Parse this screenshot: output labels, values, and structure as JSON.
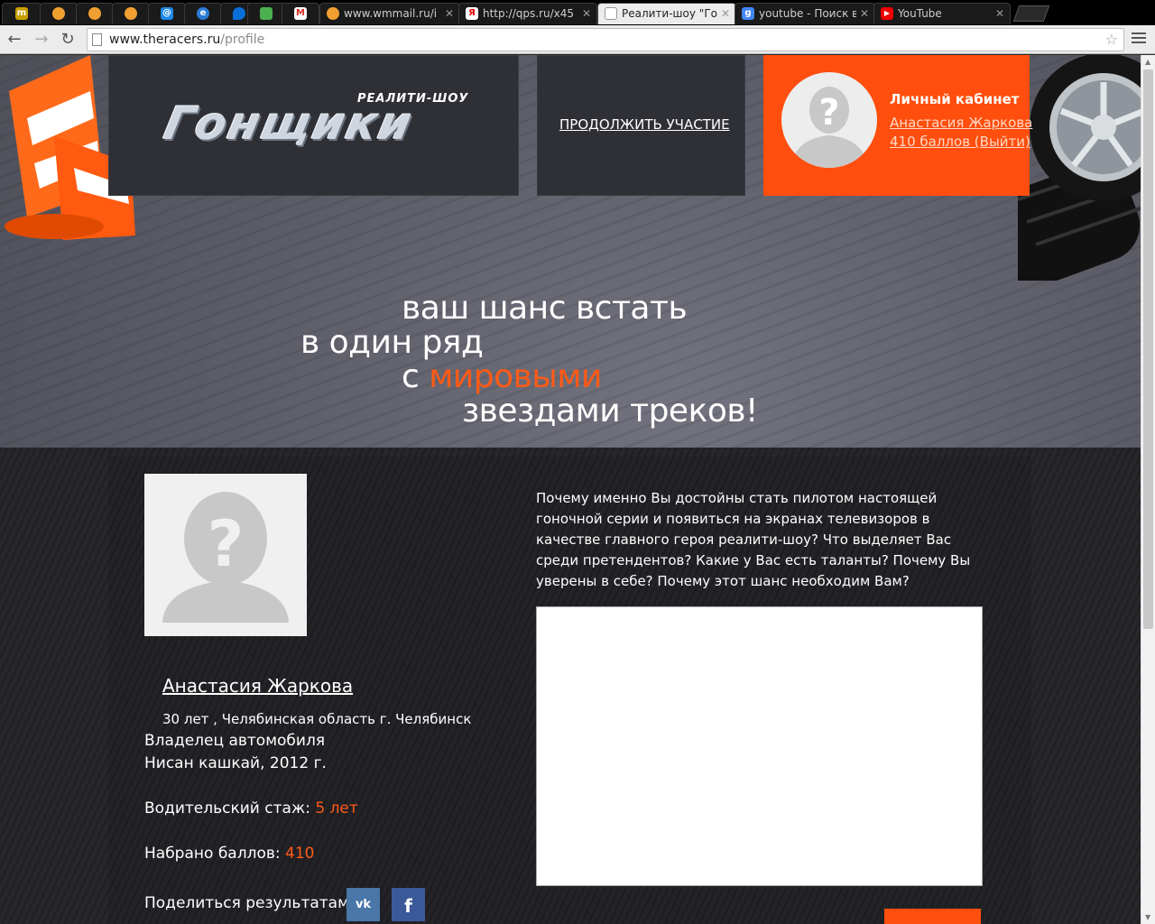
{
  "browser": {
    "tabs": [
      {
        "label": "",
        "icon": "tm-icon"
      },
      {
        "label": "",
        "icon": "ball-icon"
      },
      {
        "label": "",
        "icon": "ball-icon"
      },
      {
        "label": "",
        "icon": "ball-icon"
      },
      {
        "label": "",
        "icon": "at-icon"
      },
      {
        "label": "",
        "icon": "globe-icon"
      },
      {
        "label": "",
        "icon": "pin-icon"
      },
      {
        "label": "",
        "icon": "image-icon"
      },
      {
        "label": "",
        "icon": "gmail-icon"
      },
      {
        "label": "www.wmmail.ru/i",
        "icon": "ball-icon"
      },
      {
        "label": "http://qps.ru/x45",
        "icon": "yandex-icon"
      },
      {
        "label": "Реалити-шоу \"Го",
        "icon": "page-icon"
      },
      {
        "label": "youtube - Поиск в",
        "icon": "google-icon"
      },
      {
        "label": "YouTube",
        "icon": "youtube-icon"
      }
    ],
    "url_domain": "www.theracers.ru",
    "url_path": "/profile"
  },
  "header": {
    "logo_subtitle": "РЕАЛИТИ-ШОУ",
    "logo_title": "Гонщики",
    "continue_label": "ПРОДОЛЖИТЬ УЧАСТИЕ",
    "cabinet_title": "Личный кабинет",
    "cabinet_name": "Анастасия Жаркова",
    "cabinet_points": "410 баллов (Выйти)"
  },
  "slogan": {
    "line1": "ваш шанс встать",
    "line2": "в один ряд",
    "line3_prefix": "с ",
    "line3_highlight": "мировыми",
    "line4": "звездами треков!"
  },
  "profile": {
    "name": "Анастасия Жаркова",
    "age_location": "30 лет , Челябинская область г. Челябинск",
    "owner_label": "Владелец автомобиля",
    "car": "Нисан кашкай, 2012 г.",
    "experience_label": "Водительский стаж: ",
    "experience_value": "5 лет",
    "points_label": "Набрано баллов: ",
    "points_value": "410",
    "share_label": "Поделиться результатами:",
    "share_vk": "vk",
    "share_fb": "f"
  },
  "question": {
    "text": "Почему именно Вы достойны стать пилотом настоящей гоночной серии и появиться на экранах телевизоров в качестве главного героя реалити-шоу? Что выделяет Вас среди претендентов? Какие у Вас есть таланты? Почему Вы уверены в себе? Почему этот шанс необходим Вам?",
    "answer_value": ""
  },
  "colors": {
    "accent": "#ff4e0d",
    "highlight": "#ff5a17",
    "panel": "#2f2f36"
  }
}
